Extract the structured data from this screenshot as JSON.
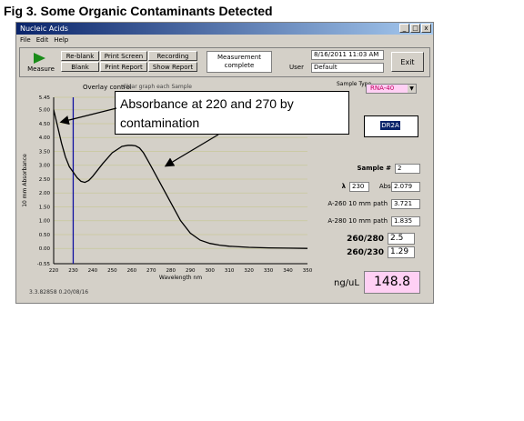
{
  "figure_title": "Fig 3. Some Organic Contaminants Detected",
  "window": {
    "title": "Nucleic Acids",
    "controls": [
      "_",
      "□",
      "x"
    ]
  },
  "menu": [
    "File",
    "Edit",
    "Help"
  ],
  "toolbar": {
    "measure_label": "Measure",
    "buttons": {
      "reblank": "Re-blank",
      "blank": "Blank",
      "print_screen": "Print Screen",
      "print_report": "Print Report",
      "recording": "Recording",
      "show_report": "Show Report"
    },
    "status": "Measurement complete",
    "datetime": "8/16/2011 11:03 AM",
    "user_label": "User",
    "user": "Default",
    "exit_label": "Exit"
  },
  "overlay": {
    "label": "Overlay control",
    "selected": "Clear graph each Sample"
  },
  "sample_type": {
    "label": "Sample Type",
    "value": "RNA-40"
  },
  "sample_id": "DR2A",
  "sample_number": {
    "label": "Sample #",
    "value": "2"
  },
  "lambda": {
    "label": "λ",
    "value": "230"
  },
  "abs": {
    "label": "Abs.",
    "value": "2.079"
  },
  "a260": {
    "label": "A-260 10 mm path",
    "value": "3.721"
  },
  "a280": {
    "label": "A-280 10 mm path",
    "value": "1.835"
  },
  "ratio_260_280": {
    "label": "260/280",
    "value": "2.5"
  },
  "ratio_260_230": {
    "label": "260/230",
    "value": "1.29"
  },
  "concentration": {
    "unit": "ng/uL",
    "value": "148.8"
  },
  "version": "3.3.82858 0.20/08/16",
  "callout": {
    "line1": "Absorbance at 220 and 270 by",
    "line2": "contamination"
  },
  "chart_data": {
    "type": "line",
    "title": "",
    "xlabel": "Wavelength nm",
    "ylabel": "10 mm Absorbance",
    "xlim": [
      220,
      350
    ],
    "ylim": [
      -0.55,
      5.45
    ],
    "x_ticks": [
      "220",
      "230",
      "240",
      "250",
      "260",
      "270",
      "280",
      "290",
      "300",
      "310",
      "320",
      "330",
      "340",
      "350"
    ],
    "y_ticks": [
      "5.45",
      "5.00",
      "4.50",
      "4.00",
      "3.50",
      "3.00",
      "2.50",
      "2.00",
      "1.50",
      "1.00",
      "0.50",
      "0.00",
      "-0.55"
    ],
    "grid": true,
    "marker_x": 230,
    "series": [
      {
        "x": [
          220,
          222,
          224,
          226,
          228,
          230,
          232,
          234,
          236,
          238,
          240,
          245,
          250,
          255,
          258,
          260,
          262,
          264,
          266,
          268,
          270,
          275,
          280,
          285,
          290,
          295,
          300,
          305,
          310,
          320,
          330,
          340,
          350
        ],
        "y": [
          5.0,
          4.4,
          3.8,
          3.3,
          2.95,
          2.75,
          2.55,
          2.42,
          2.38,
          2.45,
          2.6,
          3.05,
          3.45,
          3.68,
          3.72,
          3.72,
          3.7,
          3.62,
          3.45,
          3.2,
          2.95,
          2.3,
          1.65,
          1.0,
          0.55,
          0.3,
          0.18,
          0.12,
          0.08,
          0.04,
          0.02,
          0.01,
          0.0
        ]
      }
    ]
  }
}
